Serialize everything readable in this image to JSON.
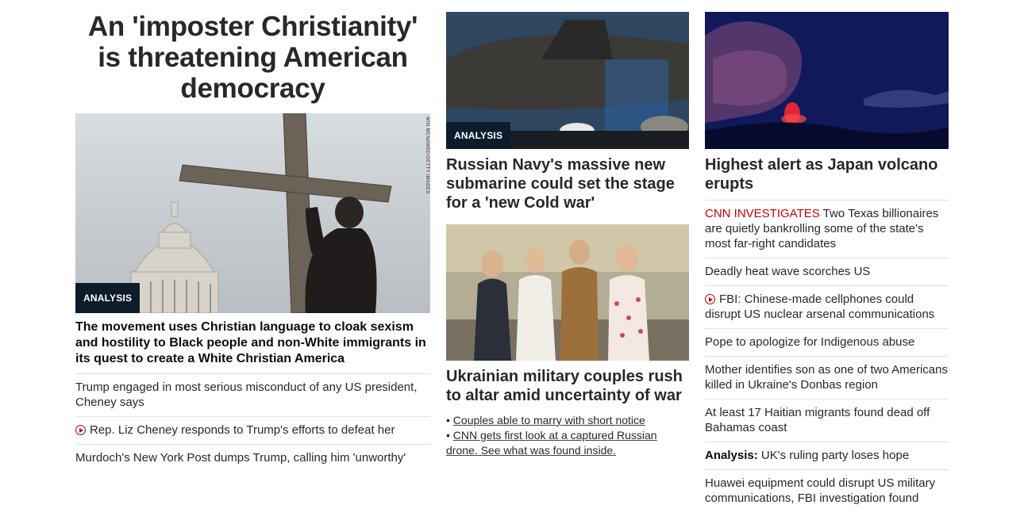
{
  "lead": {
    "title": "An 'imposter Christianity' is threatening American democracy",
    "badge": "ANALYSIS",
    "photo_credit": "WIN MCNAMEE/GETTY IMAGES",
    "subhead": "The movement uses Christian language to cloak sexism and hostility to Black people and non-White immigrants in its quest to create a White Christian America",
    "related": [
      {
        "text": "Trump engaged in most serious misconduct of any US president, Cheney says",
        "video": false
      },
      {
        "text": "Rep. Liz Cheney responds to Trump's efforts to defeat her",
        "video": true
      },
      {
        "text": "Murdoch's New York Post dumps Trump, calling him 'unworthy'",
        "video": false
      }
    ]
  },
  "submarine": {
    "badge": "ANALYSIS",
    "title": "Russian Navy's massive new submarine could set the stage for a 'new Cold war'"
  },
  "wedding": {
    "title": "Ukrainian military couples rush to altar amid uncertainty of war",
    "bullets": [
      "Couples able to marry with short notice",
      "CNN gets first look at a captured Russian drone. See what was found inside."
    ]
  },
  "volcano": {
    "title": "Highest alert as Japan volcano erupts"
  },
  "headlines": [
    {
      "prefix": "CNN INVESTIGATES",
      "prefix_style": "red",
      "text": "Two Texas billionaires are quietly bankrolling some of the state's most far-right candidates",
      "video": false
    },
    {
      "prefix": "",
      "prefix_style": "",
      "text": "Deadly heat wave scorches US",
      "video": false
    },
    {
      "prefix": "",
      "prefix_style": "",
      "text": "FBI: Chinese-made cellphones could disrupt US nuclear arsenal communications",
      "video": true
    },
    {
      "prefix": "",
      "prefix_style": "",
      "text": "Pope to apologize for Indigenous abuse",
      "video": false
    },
    {
      "prefix": "",
      "prefix_style": "",
      "text": "Mother identifies son as one of two Americans killed in Ukraine's Donbas region",
      "video": false
    },
    {
      "prefix": "",
      "prefix_style": "",
      "text": "At least 17 Haitian migrants found dead off Bahamas coast",
      "video": false
    },
    {
      "prefix": "Analysis:",
      "prefix_style": "bold",
      "text": "UK's ruling party loses hope",
      "video": false
    },
    {
      "prefix": "",
      "prefix_style": "",
      "text": "Huawei equipment could disrupt US military communications, FBI investigation found",
      "video": false
    }
  ],
  "colors": {
    "accent_red": "#cc0000",
    "badge_bg": "#0c1c2c",
    "text": "#282828",
    "divider": "#e2e2e2"
  }
}
